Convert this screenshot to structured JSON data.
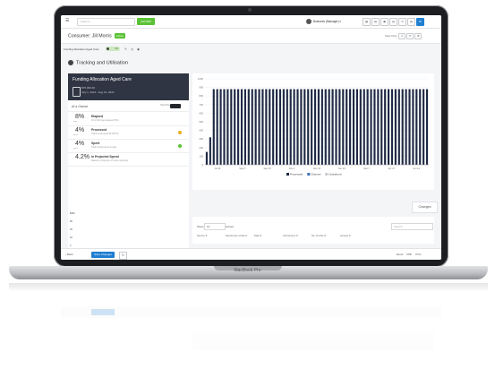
{
  "topbar": {
    "search_placeholder": "Search...",
    "action_label": "Add PRF",
    "user": "Business (Manager) ▾",
    "icon_names": [
      "grid-icon",
      "document-icon",
      "calendar-icon",
      "chart-icon",
      "message-icon",
      "mail-icon",
      "settings-icon"
    ]
  },
  "consumer": {
    "title": "Consumer: Jill Morris",
    "status": "Active",
    "view_label": "View Only"
  },
  "funding_row": {
    "label": "Funding Allocation Aged Care",
    "toggle": "ON"
  },
  "section": {
    "title": "Tracking and Utilisation"
  },
  "fund": {
    "title": "Funding Allocation Aged Care",
    "amount": "$75,000.00",
    "dates": "July 1, 2021 - Aug 31, 2022"
  },
  "glance": {
    "label": "At a Glance",
    "toggle_label": "Hide/Show"
  },
  "stats": [
    {
      "pct": "8",
      "sub": "days",
      "name": "Elapsed",
      "desc": "18 of 422 days elapsed (5%)",
      "dot": ""
    },
    {
      "pct": "4",
      "sub": "spent",
      "name": "Processed",
      "desc": "Claims processed $3,250.00",
      "dot": "#e7b21a"
    },
    {
      "pct": "4",
      "sub": "spent",
      "name": "Spent",
      "desc": "Total funding spent to date",
      "dot": "#5bc236"
    },
    {
      "pct": "4.2",
      "sub": "",
      "name": "In Projected Spend",
      "desc": "Based on projection of future spending",
      "dot": ""
    }
  ],
  "chart_data": {
    "type": "bar",
    "title": "",
    "xlabel": "",
    "ylabel": "",
    "x_ticks": [
      "Jul 29",
      "Sep 5",
      "Sep 15",
      "Nov 1",
      "Dec 15",
      "Jan 29",
      "Mar 7",
      "Apr 27",
      "Jun 13"
    ],
    "y_ticks": [
      "0",
      "100",
      "200",
      "300",
      "400",
      "500",
      "600",
      "700",
      "800",
      "900",
      "1000"
    ],
    "ylim": [
      0,
      1000
    ],
    "values": [
      150,
      320,
      880,
      880,
      880,
      880,
      880,
      880,
      880,
      880,
      880,
      880,
      880,
      880,
      880,
      880,
      880,
      880,
      880,
      880,
      880,
      880,
      880,
      880,
      880,
      880,
      880,
      880,
      880,
      880,
      880,
      880,
      880,
      880,
      880,
      880,
      880,
      880,
      880,
      880,
      880,
      880,
      880,
      880,
      880,
      880,
      880,
      880,
      880,
      880,
      880,
      880,
      880,
      880,
      880,
      880,
      880,
      880,
      880,
      880,
      880,
      880,
      880,
      880
    ],
    "legend": [
      "Processed",
      "Claimed",
      "Unclaimed"
    ],
    "legend_colors": [
      "#1f2a44",
      "#3f6fb5",
      "#c8ccd2"
    ],
    "bar_color": "#1f2a44",
    "legend_position": "bottom"
  },
  "mini_axis": {
    "labels": [
      "$100",
      "50",
      "25",
      "10",
      "0"
    ]
  },
  "changes": {
    "label": "Changes"
  },
  "table": {
    "show_label": "Show",
    "show_value": "10",
    "entries_label": "entries",
    "search_placeholder": "Search",
    "headers": [
      "Service",
      "Service Item Code",
      "Date",
      "Unit Amount",
      "No. of Units",
      "Amount"
    ]
  },
  "bottom": {
    "back_label": "‹ Back",
    "save_label": "Save Changes",
    "exports": [
      "Excel",
      "PDF",
      "Print"
    ]
  },
  "laptop": {
    "model": "MacBook Pro"
  }
}
